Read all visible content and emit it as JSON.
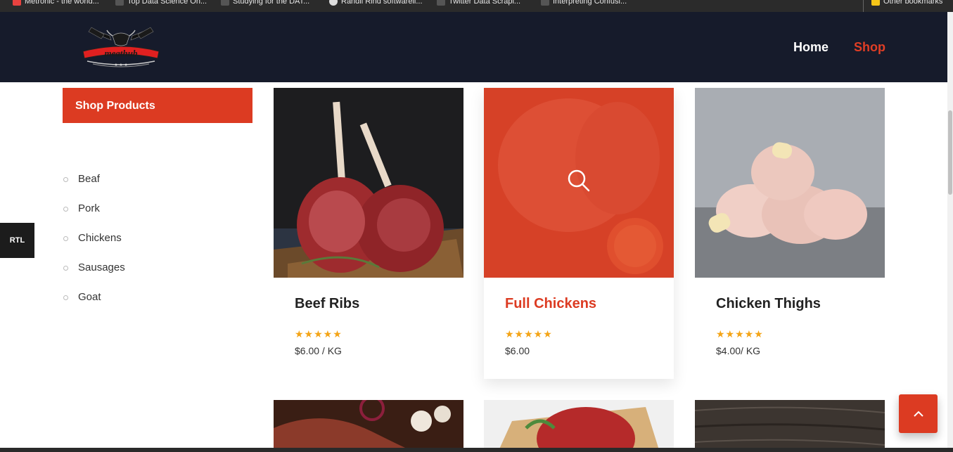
{
  "bookmarks": [
    {
      "label": "Metronic - the world...",
      "icon": "metronic-icon",
      "color": "#e8423f"
    },
    {
      "label": "Top Data Science On...",
      "icon": "bookmark-icon"
    },
    {
      "label": "Studying for the DAT...",
      "icon": "bookmark-icon"
    },
    {
      "label": "Randii Rind softwarell...",
      "icon": "globe-icon"
    },
    {
      "label": "Twitter Data Scrapi...",
      "icon": "bookmark-icon"
    },
    {
      "label": "Interpreting Confusi...",
      "icon": "bookmark-icon"
    },
    {
      "label": "Other bookmarks",
      "icon": "folder-icon",
      "color": "#f5c518"
    }
  ],
  "header": {
    "brand": "meathub",
    "nav": [
      {
        "label": "Home",
        "active": false
      },
      {
        "label": "Shop",
        "active": true
      }
    ]
  },
  "sidebar": {
    "title": "Shop Products",
    "categories": [
      "Beaf",
      "Pork",
      "Chickens",
      "Sausages",
      "Goat"
    ]
  },
  "rtl_button": "RTL",
  "products": [
    {
      "name": "Beef Ribs",
      "stars": "★★★★★",
      "rating": 5,
      "price": "$6.00 / KG",
      "hover": false,
      "image": "beef-ribs-image"
    },
    {
      "name": "Full Chickens",
      "stars": "★★★★★",
      "rating": 5,
      "price": "$6.00",
      "hover": true,
      "image": "full-chicken-image"
    },
    {
      "name": "Chicken Thighs",
      "stars": "★★★★★",
      "rating": 5,
      "price": "$4.00/ KG",
      "hover": false,
      "image": "chicken-thighs-image"
    }
  ],
  "colors": {
    "accent": "#dc3b22",
    "header_bg": "#161b2b",
    "star": "#f4a416"
  }
}
